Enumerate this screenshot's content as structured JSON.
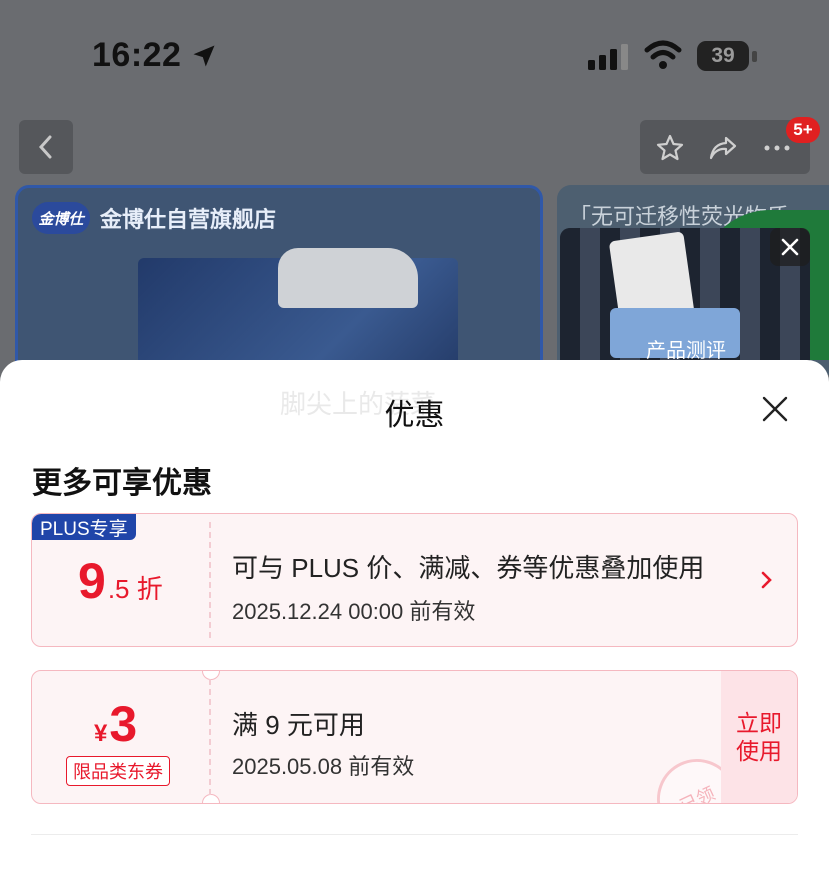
{
  "status_bar": {
    "time": "16:22",
    "battery": "39",
    "icons": [
      "location-arrow-icon",
      "signal-icon",
      "wifi-icon",
      "battery-icon"
    ]
  },
  "nav": {
    "icons": [
      "back-icon",
      "star-icon",
      "share-icon",
      "more-icon"
    ],
    "badge": "5+"
  },
  "background": {
    "shop_name": "金博仕自营旗舰店",
    "shop_logo_text": "金博仕",
    "right_banner_text": "「无可迁移性荧光物质」",
    "video_label": "产品测评"
  },
  "sheet": {
    "ghost_text": "脚尖上的菠菜",
    "title": "优惠",
    "section_title": "更多可享优惠",
    "cards": [
      {
        "tag": "PLUS专享",
        "discount_big": "9",
        "discount_small": ".5 折",
        "title": "可与 PLUS 价、满减、券等优惠叠加使用",
        "date": "2025.12.24 00:00 前有效"
      },
      {
        "currency": "¥",
        "amount": "3",
        "type": "限品类东券",
        "title": "满 9 元可用",
        "date": "2025.05.08 前有效",
        "action": "立即\n使用",
        "stamp": "已领"
      }
    ]
  },
  "colors": {
    "accent": "#e8192c",
    "plus_blue": "#2045a9",
    "card_border": "#f5b8c0",
    "card_bg": "#fdf4f5"
  }
}
